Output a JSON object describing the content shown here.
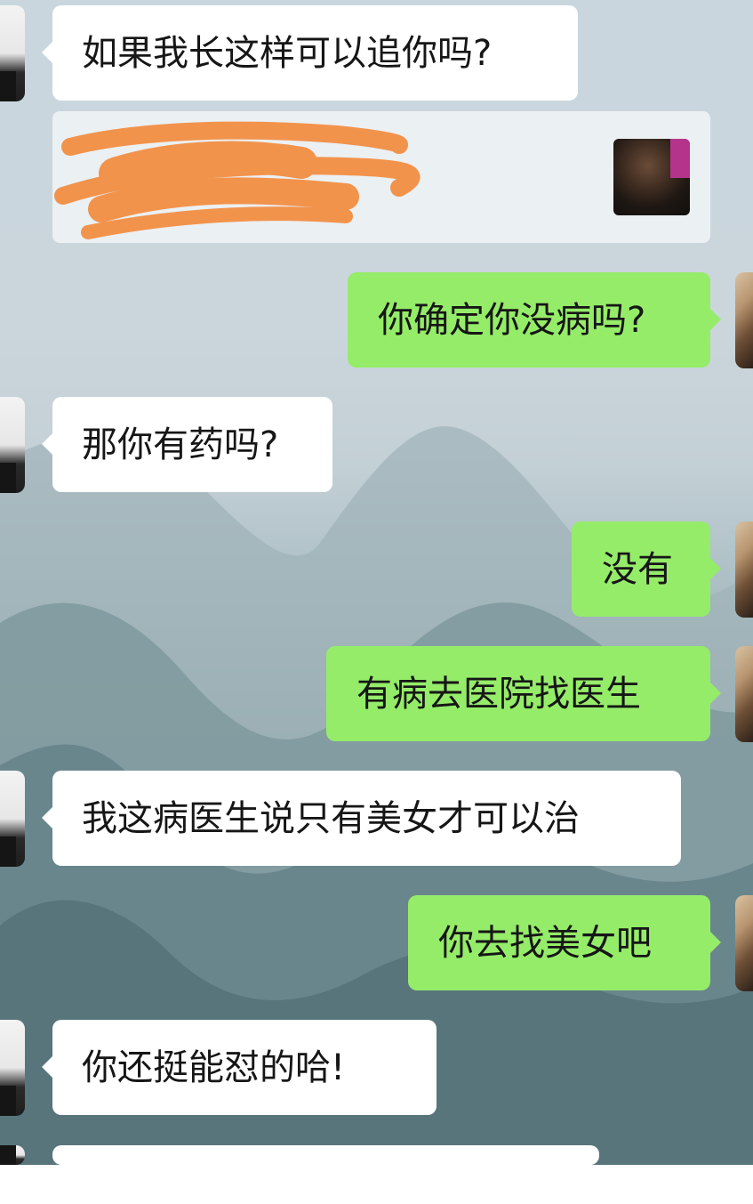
{
  "messages": [
    {
      "side": "left",
      "text": "如果我长这样可以追你吗?"
    },
    {
      "side": "right",
      "text": "你确定你没病吗?"
    },
    {
      "side": "left",
      "text": "那你有药吗?"
    },
    {
      "side": "right",
      "text": "没有"
    },
    {
      "side": "right",
      "text": "有病去医院找医生"
    },
    {
      "side": "left",
      "text": "我这病医生说只有美女才可以治"
    },
    {
      "side": "right",
      "text": "你去找美女吧"
    },
    {
      "side": "left",
      "text": "你还挺能怼的哈!"
    }
  ],
  "shared_card": {
    "redacted": true
  },
  "colors": {
    "incoming_bubble": "#ffffff",
    "outgoing_bubble": "#95ec69",
    "redaction": "#f2934c"
  }
}
